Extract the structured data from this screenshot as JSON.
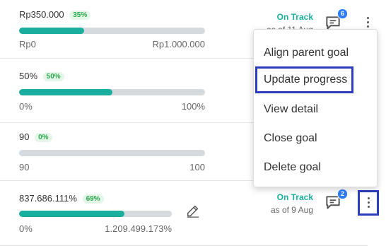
{
  "goals": [
    {
      "current": "Rp350.000",
      "percent_label": "35%",
      "progress": 0.35,
      "min": "Rp0",
      "max": "Rp1.000.000",
      "status": "On Track",
      "as_of": "as of 11 Aug",
      "comment_count": "6"
    },
    {
      "current": "50%",
      "percent_label": "50%",
      "progress": 0.5,
      "min": "0%",
      "max": "100%"
    },
    {
      "current": "90",
      "percent_label": "0%",
      "progress": 0.0,
      "min": "90",
      "max": "100"
    },
    {
      "current": "837.686.111%",
      "percent_label": "69%",
      "progress": 0.69,
      "min": "0%",
      "max": "1.209.499.173%",
      "status": "On Track",
      "as_of": "as of 9 Aug",
      "comment_count": "2"
    }
  ],
  "menu": {
    "items": [
      "Align parent goal",
      "Update progress",
      "View detail",
      "Close goal",
      "Delete goal"
    ],
    "highlighted": "Update progress"
  },
  "colors": {
    "accent": "#1aae9f",
    "track": "#d5dade",
    "badge": "#2f7df6",
    "highlight": "#2c3ebf",
    "pct_chip_bg": "#e3f6e7",
    "pct_chip_text": "#2ea84f"
  },
  "icons": {
    "comment": "comment-icon",
    "more": "kebab-menu-icon",
    "edit": "pencil-icon"
  }
}
